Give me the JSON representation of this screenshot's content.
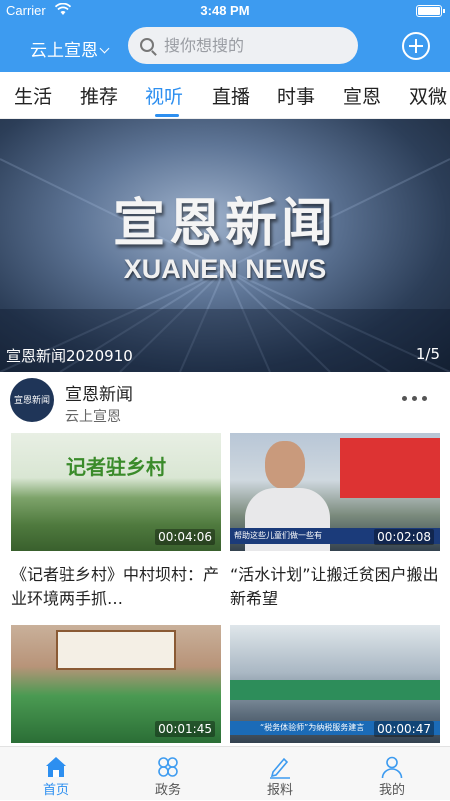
{
  "status_bar": {
    "carrier": "Carrier",
    "time": "3:48 PM"
  },
  "header": {
    "city": "云上宣恩",
    "search_placeholder": "搜你想搜的"
  },
  "tabs": [
    {
      "label": "生活"
    },
    {
      "label": "推荐"
    },
    {
      "label": "视听"
    },
    {
      "label": "直播"
    },
    {
      "label": "时事"
    },
    {
      "label": "宣恩"
    },
    {
      "label": "双微"
    }
  ],
  "active_tab": "视听",
  "banner": {
    "title": "宣恩新闻",
    "subtitle": "XUANEN NEWS",
    "caption": "宣恩新闻2020910",
    "index": "1/5"
  },
  "channel": {
    "avatar_text": "宣恩新闻",
    "name": "宣恩新闻",
    "source": "云上宣恩"
  },
  "videos": [
    {
      "title": "《记者驻乡村》中村坝村：产业环境两手抓…",
      "duration": "00:04:06",
      "thumb_text": "记者驻乡村"
    },
    {
      "title": "“活水计划”让搬迁贫困户搬出新希望",
      "duration": "00:02:08",
      "thumb_text": "帮助这些儿童们做一些有"
    },
    {
      "title": "",
      "duration": "00:01:45",
      "thumb_text": ""
    },
    {
      "title": "",
      "duration": "00:00:47",
      "thumb_text": "“税务体验师”为纳税服务建言"
    }
  ],
  "bottom_nav": [
    {
      "label": "首页",
      "icon": "home-icon"
    },
    {
      "label": "政务",
      "icon": "clover-icon"
    },
    {
      "label": "报料",
      "icon": "pen-icon"
    },
    {
      "label": "我的",
      "icon": "user-icon"
    }
  ],
  "colors": {
    "brand": "#3d9bf0",
    "active": "#2d8ff0"
  }
}
